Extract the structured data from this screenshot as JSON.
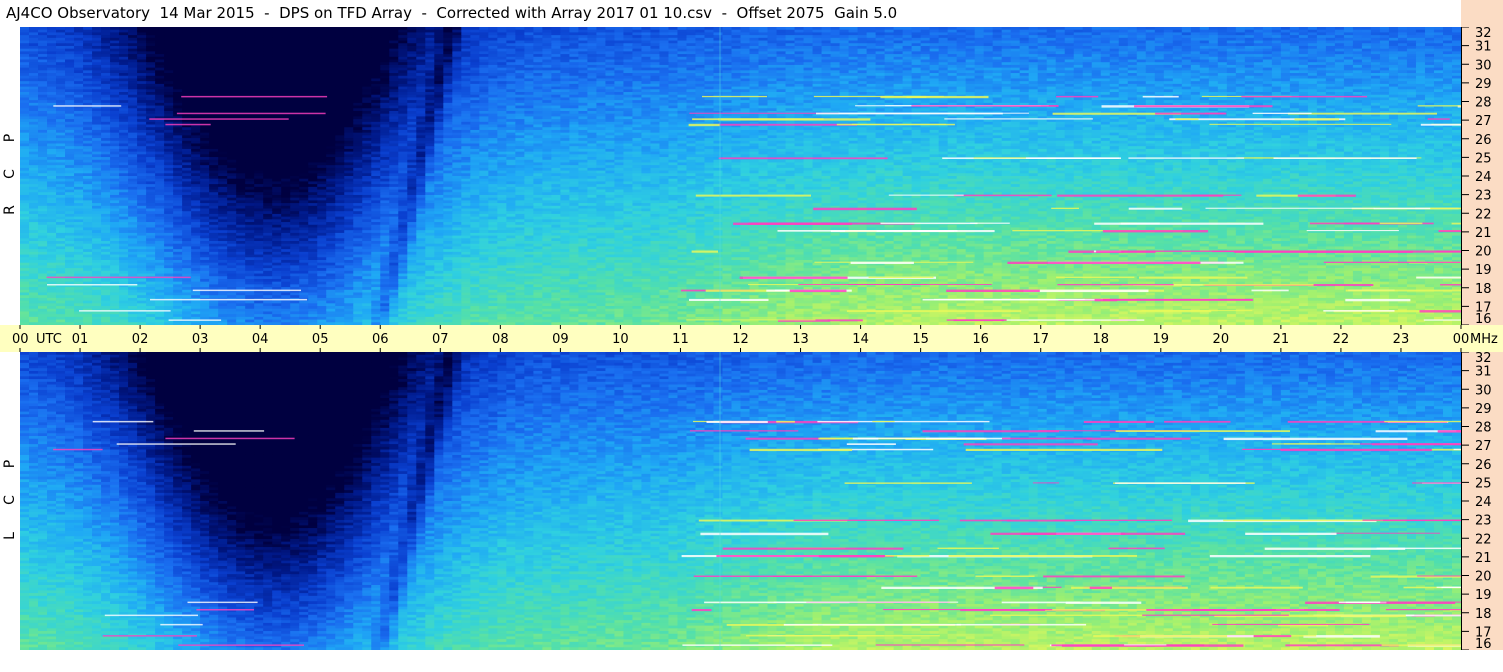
{
  "title": "AJ4CO Observatory  14 Mar 2015  -  DPS on TFD Array  -  Corrected with Array 2017 01 10.csv  -  Offset 2075  Gain 5.0",
  "panels": {
    "top": {
      "label_letters": [
        "R",
        "C",
        "P"
      ]
    },
    "bottom": {
      "label_letters": [
        "L",
        "C",
        "P"
      ]
    }
  },
  "colors": {
    "axis_bg_right": "#fbdcc4",
    "axis_bg_time": "#ffffc0",
    "colormap": [
      "#000040",
      "#001a8c",
      "#0a3fcf",
      "#1a6ef0",
      "#1fa8f5",
      "#2fd0e0",
      "#55e0a8",
      "#9ef070",
      "#e8f85a",
      "#ff40c0",
      "#ffffff"
    ]
  },
  "chart_data": [
    {
      "type": "heatmap",
      "panel": "top",
      "x_range": [
        0,
        24
      ],
      "y_range": [
        16,
        32
      ],
      "y_ticks": [
        "16",
        "17",
        "18",
        "19",
        "20",
        "21",
        "22",
        "23",
        "24",
        "25",
        "26",
        "27",
        "28",
        "29",
        "30",
        "31",
        "32"
      ]
    },
    {
      "type": "heatmap",
      "panel": "bottom",
      "x_range": [
        0,
        24
      ],
      "y_range": [
        16,
        32
      ],
      "y_ticks": [
        "16",
        "17",
        "18",
        "19",
        "20",
        "21",
        "22",
        "23",
        "24",
        "25",
        "26",
        "27",
        "28",
        "29",
        "30",
        "31",
        "32"
      ]
    }
  ],
  "time_axis": {
    "ticks": [
      "00",
      "01",
      "02",
      "03",
      "04",
      "05",
      "06",
      "07",
      "08",
      "09",
      "10",
      "11",
      "12",
      "13",
      "14",
      "15",
      "16",
      "17",
      "18",
      "19",
      "20",
      "21",
      "22",
      "23",
      "00"
    ],
    "utc_label": "UTC",
    "mhz_label": "MHz"
  }
}
